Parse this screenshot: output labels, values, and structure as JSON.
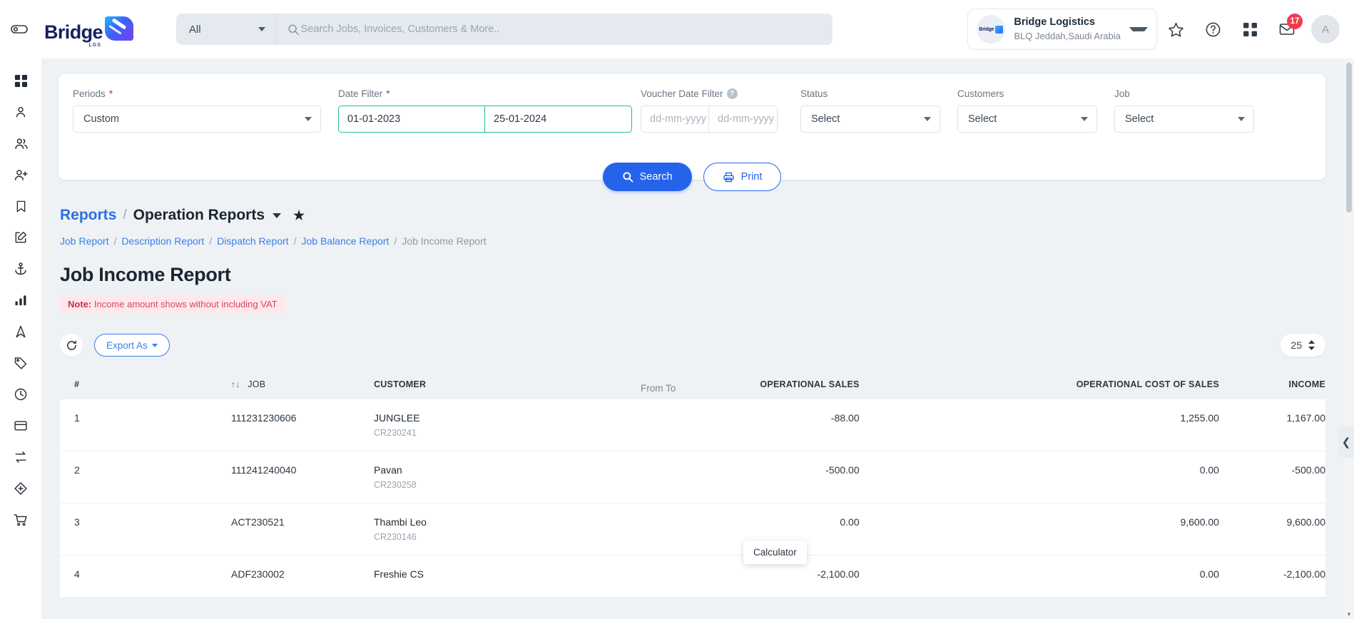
{
  "topbar": {
    "brand_name": "Bridge",
    "brand_sub": "LGS",
    "search_category": "All",
    "search_placeholder": "Search Jobs, Invoices, Customers & More..",
    "search_value": "",
    "org_name": "Bridge Logistics",
    "org_location": "BLQ Jeddah,Saudi Arabia",
    "org_logo_text": "Bridge",
    "mail_badge": "17",
    "avatar_initial": "A"
  },
  "sidebar": {
    "items": [
      {
        "name": "dashboard-icon"
      },
      {
        "name": "user-icon"
      },
      {
        "name": "users-icon"
      },
      {
        "name": "user-add-icon"
      },
      {
        "name": "bookmark-icon"
      },
      {
        "name": "edit-icon"
      },
      {
        "name": "anchor-icon"
      },
      {
        "name": "bar-chart-icon"
      },
      {
        "name": "navigation-icon"
      },
      {
        "name": "tag-icon"
      },
      {
        "name": "clock-icon"
      },
      {
        "name": "credit-card-icon"
      },
      {
        "name": "sync-icon"
      },
      {
        "name": "package-icon"
      },
      {
        "name": "cart-icon"
      }
    ]
  },
  "filters": {
    "periods_label": "Periods",
    "periods_value": "Custom",
    "date_filter_label": "Date Filter",
    "date_from": "01-01-2023",
    "date_to": "25-01-2024",
    "voucher_label": "Voucher Date Filter",
    "voucher_from_placeholder": "dd-mm-yyyy",
    "voucher_to_placeholder": "dd-mm-yyyy",
    "voucher_from": "",
    "voucher_to": "",
    "status_label": "Status",
    "status_value": "Select",
    "customers_label": "Customers",
    "customers_value": "Select",
    "job_label": "Job",
    "job_value": "Select",
    "search_button": "Search",
    "print_button": "Print"
  },
  "breadcrumb": {
    "root": "Reports",
    "separator": "/",
    "current": "Operation Reports",
    "sub_links": [
      "Job Report",
      "Description Report",
      "Dispatch Report",
      "Job Balance Report"
    ],
    "sub_current": "Job Income Report"
  },
  "report": {
    "title": "Job Income Report",
    "note_prefix": "Note:",
    "note_text": "Income amount shows without including VAT",
    "from_to": "From To"
  },
  "toolbar": {
    "export_label": "Export As",
    "page_size": "25"
  },
  "table": {
    "headers": [
      "#",
      "JOB",
      "CUSTOMER",
      "OPERATIONAL SALES",
      "OPERATIONAL COST OF SALES",
      "INCOME"
    ],
    "rows": [
      {
        "index": "1",
        "job": "111231230606",
        "customer": "JUNGLEE",
        "customer_code": "CR230241",
        "operational_sales": "-88.00",
        "operational_cost_of_sales": "1,255.00",
        "income": "1,167.00"
      },
      {
        "index": "2",
        "job": "111241240040",
        "customer": "Pavan",
        "customer_code": "CR230258",
        "operational_sales": "-500.00",
        "operational_cost_of_sales": "0.00",
        "income": "-500.00"
      },
      {
        "index": "3",
        "job": "ACT230521",
        "customer": "Thambi Leo",
        "customer_code": "CR230146",
        "operational_sales": "0.00",
        "operational_cost_of_sales": "9,600.00",
        "income": "9,600.00"
      },
      {
        "index": "4",
        "job": "ADF230002",
        "customer": "Freshie CS",
        "customer_code": "",
        "operational_sales": "-2,100.00",
        "operational_cost_of_sales": "0.00",
        "income": "-2,100.00"
      }
    ]
  },
  "tooltip": {
    "text": "Calculator"
  },
  "colors": {
    "primary_blue": "#2563eb",
    "link_blue": "#3d7ee6",
    "date_border_green": "#21bf8f",
    "note_red": "#e0435b",
    "badge_red": "#f23b4c"
  }
}
